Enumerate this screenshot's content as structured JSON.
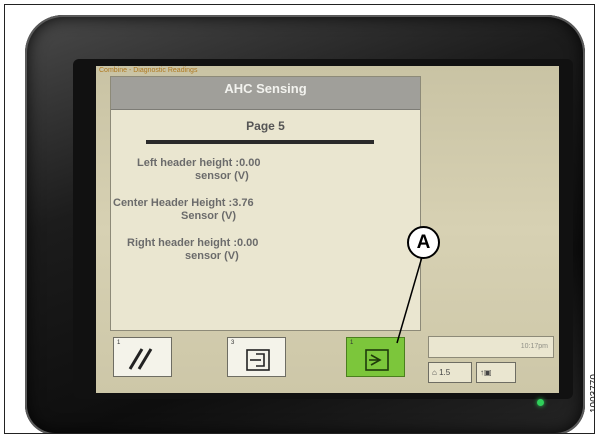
{
  "screen": {
    "breadcrumb": "Combine - Diagnostic Readings",
    "title": "AHC Sensing",
    "page_label": "Page 5",
    "readouts": [
      {
        "label_line1": "Left header height",
        "label_line2": "sensor (V)",
        "value": ":0.00"
      },
      {
        "label_line1": "Center Header Height",
        "label_line2": "Sensor (V)",
        "value": ":3.76"
      },
      {
        "label_line1": "Right header height",
        "label_line2": "sensor (V)",
        "value": ":0.00"
      }
    ],
    "softkeys": [
      {
        "number": "1",
        "icon": "diagonal-slashes-icon",
        "active": false
      },
      {
        "number": "3",
        "icon": "page-back-icon",
        "active": false
      },
      {
        "number": "1",
        "icon": "page-forward-icon",
        "active": true
      }
    ],
    "info_box": "10:17pm",
    "mini_buttons": [
      {
        "label": "1.5",
        "icon": "home-icon"
      },
      {
        "label": "",
        "icon": "up-arrow-monitor-icon"
      }
    ],
    "colors": {
      "active_key": "#7cc63b",
      "panel_bg": "#eae6d0",
      "title_bar": "#a09f9a",
      "breadcrumb": "#b07a20",
      "led": "#2fd05a"
    }
  },
  "callout": {
    "label": "A"
  },
  "figure_id": "1003770"
}
